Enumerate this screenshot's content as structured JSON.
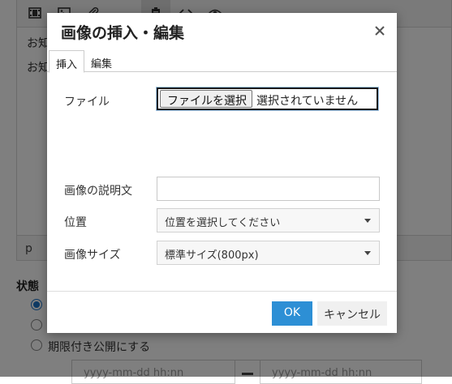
{
  "background": {
    "editor_lines": [
      "お知",
      "お知"
    ],
    "status_path": "p",
    "state_label": "状態",
    "radio_third_label": "期限付き公開にする",
    "date_placeholder": "yyyy-mm-dd hh:nn"
  },
  "dialog": {
    "title": "画像の挿入・編集",
    "tabs": [
      "挿入",
      "編集"
    ],
    "active_tab": "挿入",
    "file_label": "ファイル",
    "file_button": "ファイルを選択",
    "file_status": "選択されていません",
    "description_label": "画像の説明文",
    "description_value": "",
    "position_label": "位置",
    "position_value": "位置を選択してください",
    "size_label": "画像サイズ",
    "size_value": "標準サイズ(800px)",
    "ok_label": "OK",
    "cancel_label": "キャンセル"
  },
  "colors": {
    "ok_button": "#2d8fd5",
    "overlay": "rgba(0,0,0,0.5)",
    "radio_checked": "#1e74c9"
  },
  "icons": [
    "film-icon",
    "image-icon",
    "paperclip-icon",
    "paste-icon",
    "code-icon",
    "eye-icon",
    "close-icon",
    "chevron-down-icon"
  ]
}
